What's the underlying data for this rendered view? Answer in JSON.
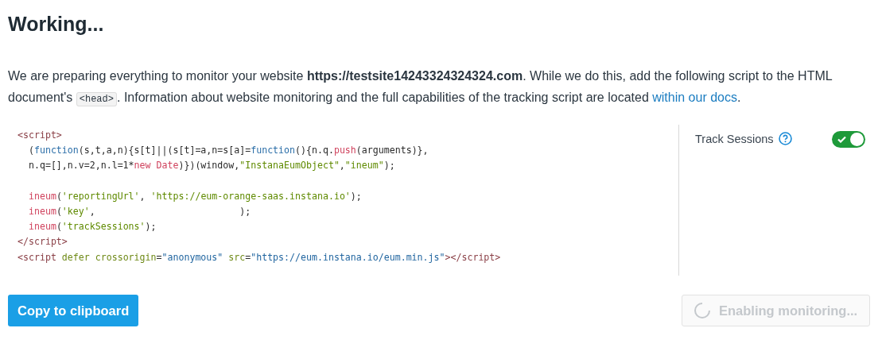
{
  "title": "Working...",
  "intro": {
    "before": "We are preparing everything to monitor your website **https://testsite14243324324324.com**. While we do this, add the following script to the HTML document's",
    "code": "<head>",
    "after": ". Information about website monitoring and the full capabilities of the tracking script are located",
    "link": "within our docs",
    "end": "."
  },
  "code_lines": [
    [
      {
        "kind": "tag",
        "text": "<script>"
      }
    ],
    [
      {
        "kind": "plain",
        "text": "  ("
      },
      {
        "kind": "keyword",
        "text": "function"
      },
      {
        "kind": "plain",
        "text": "(s,t,a,n){s[t]||(s[t]=a,n=s[a]="
      },
      {
        "kind": "keyword",
        "text": "function"
      },
      {
        "kind": "plain",
        "text": "(){n.q."
      },
      {
        "kind": "func",
        "text": "push"
      },
      {
        "kind": "plain",
        "text": "(arguments)},"
      }
    ],
    [
      {
        "kind": "plain",
        "text": "  n.q=[],n.v=2,n.l=1*"
      },
      {
        "kind": "func",
        "text": "new Date"
      },
      {
        "kind": "plain",
        "text": ")})(window,"
      },
      {
        "kind": "string",
        "text": "\"InstanaEumObject\""
      },
      {
        "kind": "plain",
        "text": ","
      },
      {
        "kind": "string",
        "text": "\"ineum\""
      },
      {
        "kind": "plain",
        "text": ");"
      }
    ],
    [
      {
        "kind": "gap"
      },
      {
        "kind": "func",
        "text": "  ineum"
      },
      {
        "kind": "plain",
        "text": "("
      },
      {
        "kind": "string",
        "text": "'reportingUrl'"
      },
      {
        "kind": "plain",
        "text": ", "
      },
      {
        "kind": "string",
        "text": "'https://eum-orange-saas.instana.io'"
      },
      {
        "kind": "plain",
        "text": ");"
      }
    ],
    [
      {
        "kind": "func",
        "text": "  ineum"
      },
      {
        "kind": "plain",
        "text": "("
      },
      {
        "kind": "string",
        "text": "'key'"
      },
      {
        "kind": "plain",
        "text": ",                          );"
      }
    ],
    [
      {
        "kind": "func",
        "text": "  ineum"
      },
      {
        "kind": "plain",
        "text": "("
      },
      {
        "kind": "string",
        "text": "'trackSessions'"
      },
      {
        "kind": "plain",
        "text": ");"
      }
    ],
    [
      {
        "kind": "tag",
        "text": "</script>"
      }
    ],
    [
      {
        "kind": "tag",
        "text": "<script"
      },
      {
        "kind": "attr",
        "text": " defer crossorigin"
      },
      {
        "kind": "plain",
        "text": "="
      },
      {
        "kind": "attrval",
        "text": "\"anonymous\""
      },
      {
        "kind": "attr",
        "text": " src"
      },
      {
        "kind": "plain",
        "text": "="
      },
      {
        "kind": "attrval",
        "text": "\"https://eum.instana.io/eum.min.js\""
      },
      {
        "kind": "tag",
        "text": "></script>"
      }
    ]
  ],
  "track_sessions": {
    "label": "Track Sessions",
    "on": true
  },
  "buttons": [
    {
      "label": "Copy to clipboard",
      "disabled": false,
      "loading": false
    },
    {
      "label": "Enabling monitoring...",
      "disabled": true,
      "loading": true
    }
  ]
}
